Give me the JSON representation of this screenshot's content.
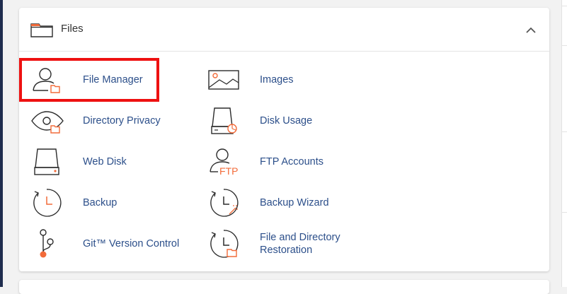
{
  "colors": {
    "link": "#2c4f8a",
    "accent": "#f26b3a",
    "highlight": "#ee1111",
    "icon_stroke": "#2b2b2b"
  },
  "section": {
    "title": "Files",
    "icon": "folder-icon",
    "collapse_icon": "chevron-up-icon"
  },
  "items": [
    {
      "label": "File Manager",
      "icon": "file-manager-icon"
    },
    {
      "label": "Images",
      "icon": "images-icon"
    },
    {
      "label": "Directory Privacy",
      "icon": "directory-privacy-icon"
    },
    {
      "label": "Disk Usage",
      "icon": "disk-usage-icon"
    },
    {
      "label": "Web Disk",
      "icon": "web-disk-icon"
    },
    {
      "label": "FTP Accounts",
      "icon": "ftp-accounts-icon"
    },
    {
      "label": "Backup",
      "icon": "backup-icon"
    },
    {
      "label": "Backup Wizard",
      "icon": "backup-wizard-icon"
    },
    {
      "label": "Git™ Version Control",
      "icon": "git-version-control-icon"
    },
    {
      "label": "File and Directory\nRestoration",
      "icon": "file-restoration-icon"
    }
  ],
  "ftp_icon_text": "FTP"
}
